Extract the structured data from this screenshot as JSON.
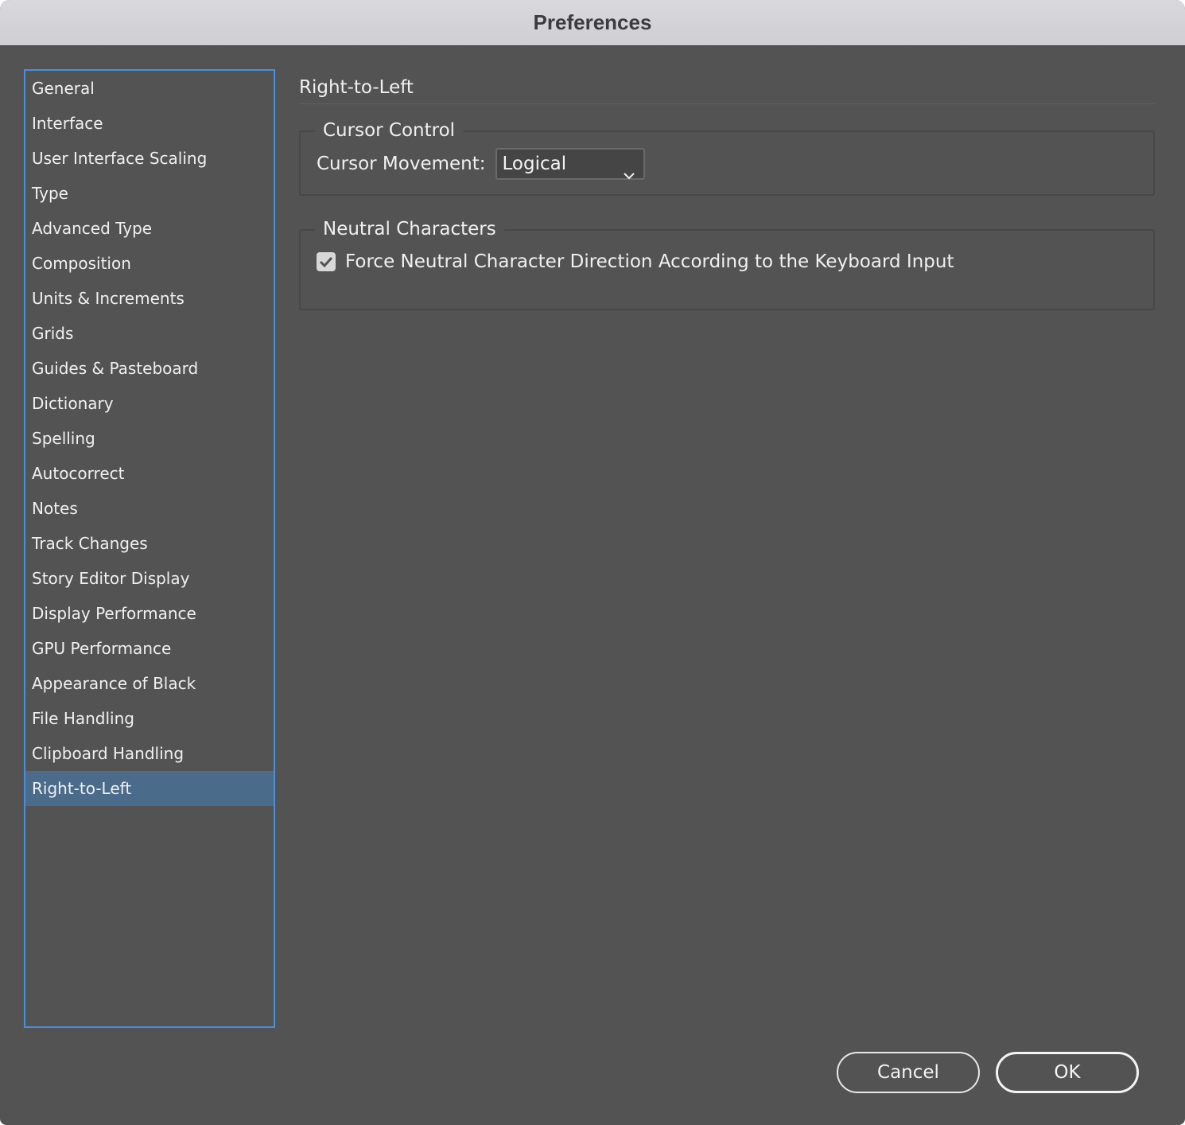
{
  "window": {
    "title": "Preferences"
  },
  "sidebar": {
    "items": [
      {
        "label": "General"
      },
      {
        "label": "Interface"
      },
      {
        "label": "User Interface Scaling"
      },
      {
        "label": "Type"
      },
      {
        "label": "Advanced Type"
      },
      {
        "label": "Composition"
      },
      {
        "label": "Units & Increments"
      },
      {
        "label": "Grids"
      },
      {
        "label": "Guides & Pasteboard"
      },
      {
        "label": "Dictionary"
      },
      {
        "label": "Spelling"
      },
      {
        "label": "Autocorrect"
      },
      {
        "label": "Notes"
      },
      {
        "label": "Track Changes"
      },
      {
        "label": "Story Editor Display"
      },
      {
        "label": "Display Performance"
      },
      {
        "label": "GPU Performance"
      },
      {
        "label": "Appearance of Black"
      },
      {
        "label": "File Handling"
      },
      {
        "label": "Clipboard Handling"
      },
      {
        "label": "Right-to-Left",
        "selected": true
      }
    ]
  },
  "main": {
    "section_title": "Right-to-Left",
    "cursor_control": {
      "legend": "Cursor Control",
      "movement_label": "Cursor Movement:",
      "movement_value": "Logical"
    },
    "neutral_characters": {
      "legend": "Neutral Characters",
      "force_direction_label": "Force Neutral Character Direction According to the Keyboard Input",
      "force_direction_checked": true
    }
  },
  "buttons": {
    "cancel": "Cancel",
    "ok": "OK"
  },
  "colors": {
    "background": "#535353",
    "selection": "#4b6b8a",
    "focus_ring": "#4a90d9",
    "titlebar": "#d4d4d8"
  }
}
